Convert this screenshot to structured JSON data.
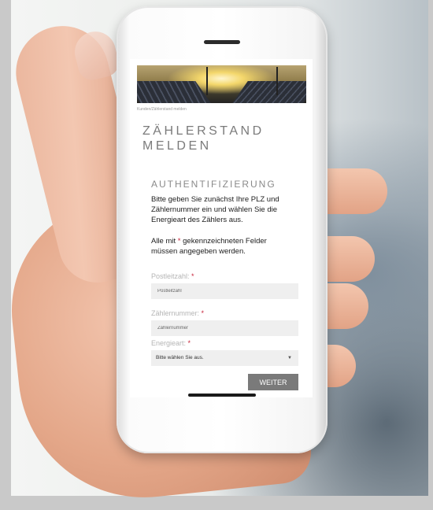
{
  "page": {
    "breadcrumb": "Kunden/Zählerstand melden",
    "title": "ZÄHLERSTAND MELDEN"
  },
  "form": {
    "section_title": "AUTHENTIFIZIERUNG",
    "intro": "Bitte geben Sie zunächst Ihre PLZ und Zählernummer ein und wählen Sie die Energieart des Zählers aus.",
    "required_note_prefix": "Alle mit",
    "required_star": "*",
    "required_note_suffix": "gekennzeichneten Felder müssen angegeben werden.",
    "fields": [
      {
        "label": "Postleitzahl:",
        "star": "*",
        "placeholder": "Postleitzahl"
      },
      {
        "label": "Zählernummer:",
        "star": "*",
        "placeholder": "Zählernummer"
      },
      {
        "label": "Energieart:",
        "star": "*",
        "selected": "Bitte wählen Sie aus."
      }
    ],
    "submit_label": "WEITER"
  },
  "colors": {
    "accent_required": "#c7243a",
    "button": "#7a7a7a"
  }
}
